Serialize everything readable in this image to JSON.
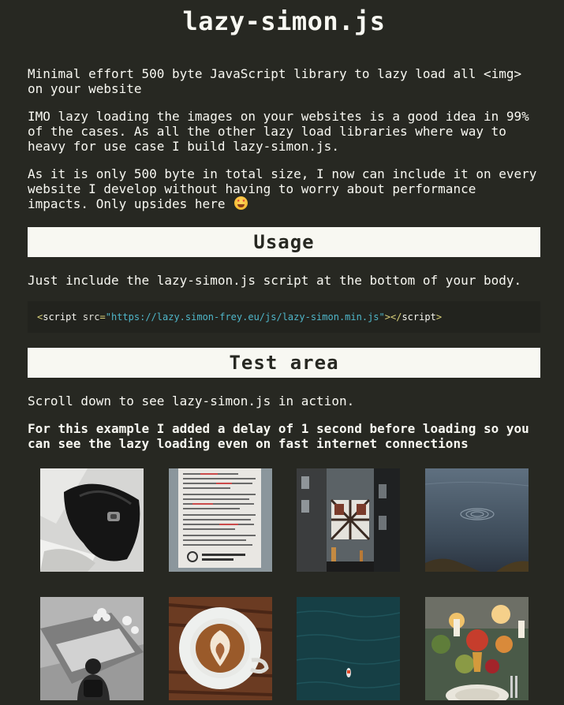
{
  "title": "lazy-simon.js",
  "intro": {
    "p1": "Minimal effort 500 byte JavaScript library to lazy load all <img> on your website",
    "p2": "IMO lazy loading the images on your websites is a good idea in 99% of the cases. As all the other lazy load libraries where way to heavy for use case I build lazy-simon.js.",
    "p3": "As it is only 500 byte in total size, I now can include it on every website I develop without having to worry about performance impacts. Only upsides here"
  },
  "usage": {
    "heading": "Usage",
    "text": "Just include the lazy-simon.js script at the bottom of your body.",
    "code": {
      "open_bracket": "<",
      "tag": "script",
      "attr": " src",
      "equals": "=",
      "quote_open": "\"",
      "src": "https://lazy.simon-frey.eu/js/lazy-simon.min.js",
      "quote_close": "\"",
      "close_open": "></",
      "close_tag": "script",
      "close_bracket": ">"
    }
  },
  "test": {
    "heading": "Test area",
    "text": "Scroll down to see lazy-simon.js in action.",
    "note": "For this example I added a delay of 1 second before loading so you can see the lazy loading even on fast internet connections"
  },
  "colors": {
    "background": "#272822",
    "text": "#f8f8f2",
    "heading_bg": "#f8f8f2",
    "code_string": "#4fb6c9"
  }
}
